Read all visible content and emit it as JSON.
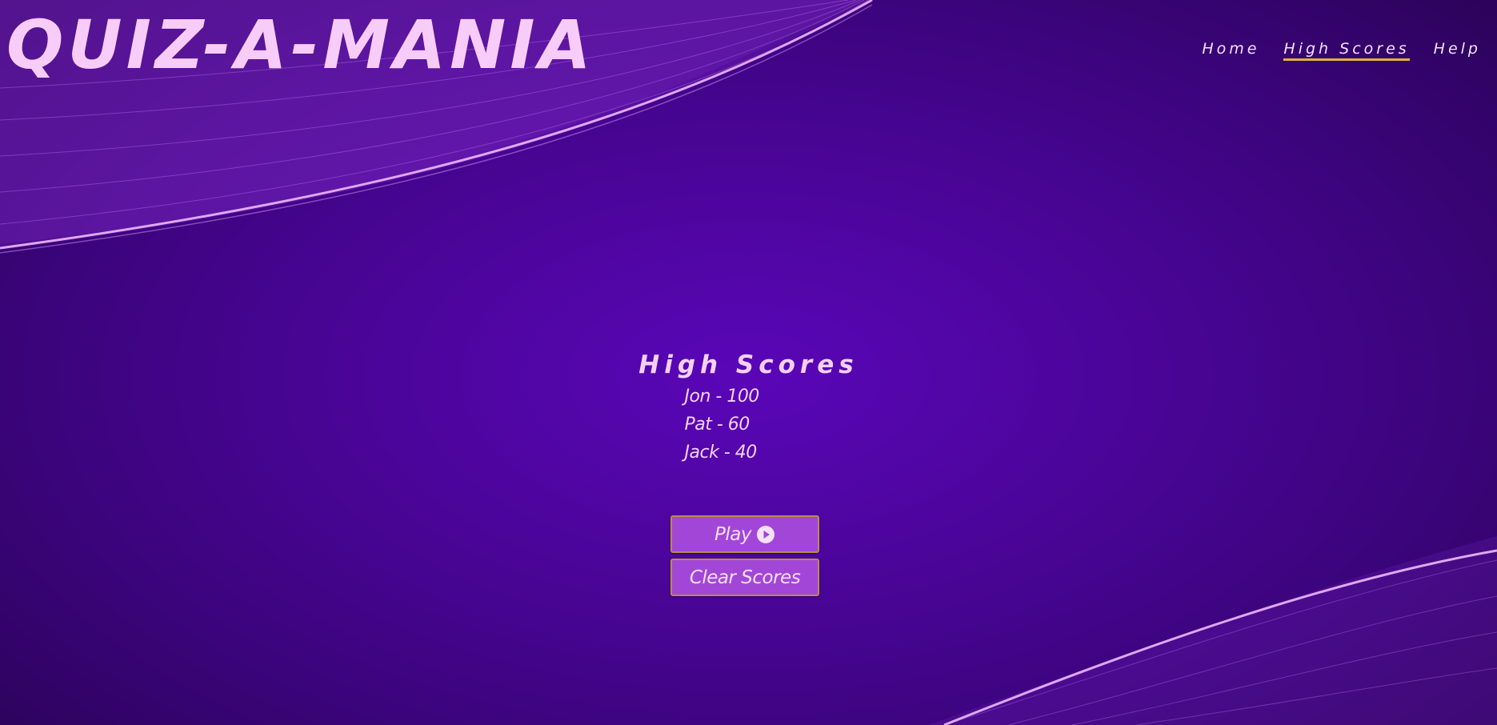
{
  "brand": {
    "title": "QUIZ-A-MANIA"
  },
  "nav": {
    "items": [
      {
        "label": "Home",
        "active": false
      },
      {
        "label": "High Scores",
        "active": true
      },
      {
        "label": "Help",
        "active": false
      }
    ]
  },
  "high_scores": {
    "heading": "High Scores",
    "entries": [
      "Jon - 100",
      "Pat - 60",
      "Jack - 40"
    ]
  },
  "actions": {
    "play_label": "Play",
    "play_icon": "play-circle-icon",
    "clear_label": "Clear Scores"
  },
  "colors": {
    "background": "#4a0598",
    "accent_text": "#f3d1f7",
    "button": "#a246d8",
    "button_border": "#b98d44",
    "nav_underline": "#e2b433"
  }
}
